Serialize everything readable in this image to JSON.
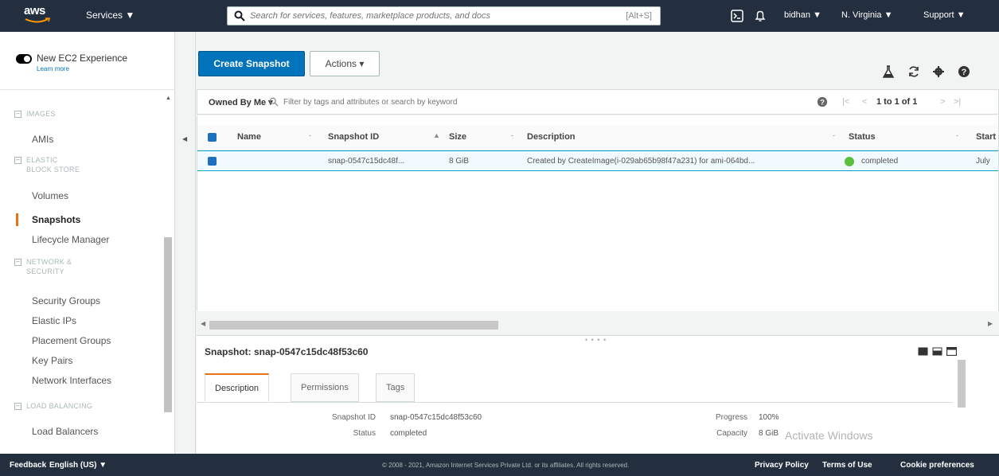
{
  "topnav": {
    "logo_text": "aws",
    "services_label": "Services ▼",
    "search_placeholder": "Search for services, features, marketplace products, and docs",
    "search_shortcut": "[Alt+S]",
    "user_label": "bidhan ▼",
    "region_label": "N. Virginia ▼",
    "support_label": "Support ▼",
    "cloudshell_icon": "terminal-icon",
    "bell_icon": "bell-icon"
  },
  "sidebar": {
    "new_experience_label": "New EC2 Experience",
    "learn_more_label": "Learn more",
    "sections": [
      {
        "title": "IMAGES",
        "items": [
          "AMIs"
        ]
      },
      {
        "title": "ELASTIC BLOCK STORE",
        "items": [
          "Volumes",
          "Snapshots",
          "Lifecycle Manager"
        ]
      },
      {
        "title": "NETWORK & SECURITY",
        "items": [
          "Security Groups",
          "Elastic IPs",
          "Placement Groups",
          "Key Pairs",
          "Network Interfaces"
        ]
      },
      {
        "title": "LOAD BALANCING",
        "items": [
          "Load Balancers"
        ]
      }
    ],
    "active_item": "Snapshots"
  },
  "toolbar": {
    "create_snapshot_label": "Create Snapshot",
    "actions_label": "Actions ▾"
  },
  "filter": {
    "owner_label": "Owned By Me ▾",
    "placeholder": "Filter by tags and attributes or search by keyword",
    "pagination": "1 to 1 of 1"
  },
  "table": {
    "columns": [
      "Name",
      "Snapshot ID",
      "Size",
      "Description",
      "Status",
      "Start"
    ],
    "rows": [
      {
        "name": "",
        "snapshot_id": "snap-0547c15dc48f...",
        "size": "8 GiB",
        "description": "Created by CreateImage(i-029ab65b98f47a231) for ami-064bd...",
        "status": "completed",
        "start": "July"
      }
    ]
  },
  "details": {
    "title": "Snapshot: snap-0547c15dc48f53c60",
    "tabs": [
      "Description",
      "Permissions",
      "Tags"
    ],
    "active_tab": "Description",
    "fields_left": [
      {
        "label": "Snapshot ID",
        "value": "snap-0547c15dc48f53c60"
      },
      {
        "label": "Status",
        "value": "completed"
      }
    ],
    "fields_right": [
      {
        "label": "Progress",
        "value": "100%"
      },
      {
        "label": "Capacity",
        "value": "8 GiB"
      }
    ]
  },
  "watermark": "Activate Windows",
  "footer": {
    "feedback_label": "Feedback",
    "language_label": "English (US) ▼",
    "copyright": "© 2008 - 2021, Amazon Internet Services Private Ltd. or its affiliates. All rights reserved.",
    "privacy_label": "Privacy Policy",
    "terms_label": "Terms of Use",
    "cookies_label": "Cookie preferences"
  },
  "colors": {
    "nav_bg": "#232f3e",
    "primary_button": "#0073bb",
    "active_accent": "#ec7211",
    "status_green": "#5bbf3c",
    "selected_row": "#f1faff"
  }
}
